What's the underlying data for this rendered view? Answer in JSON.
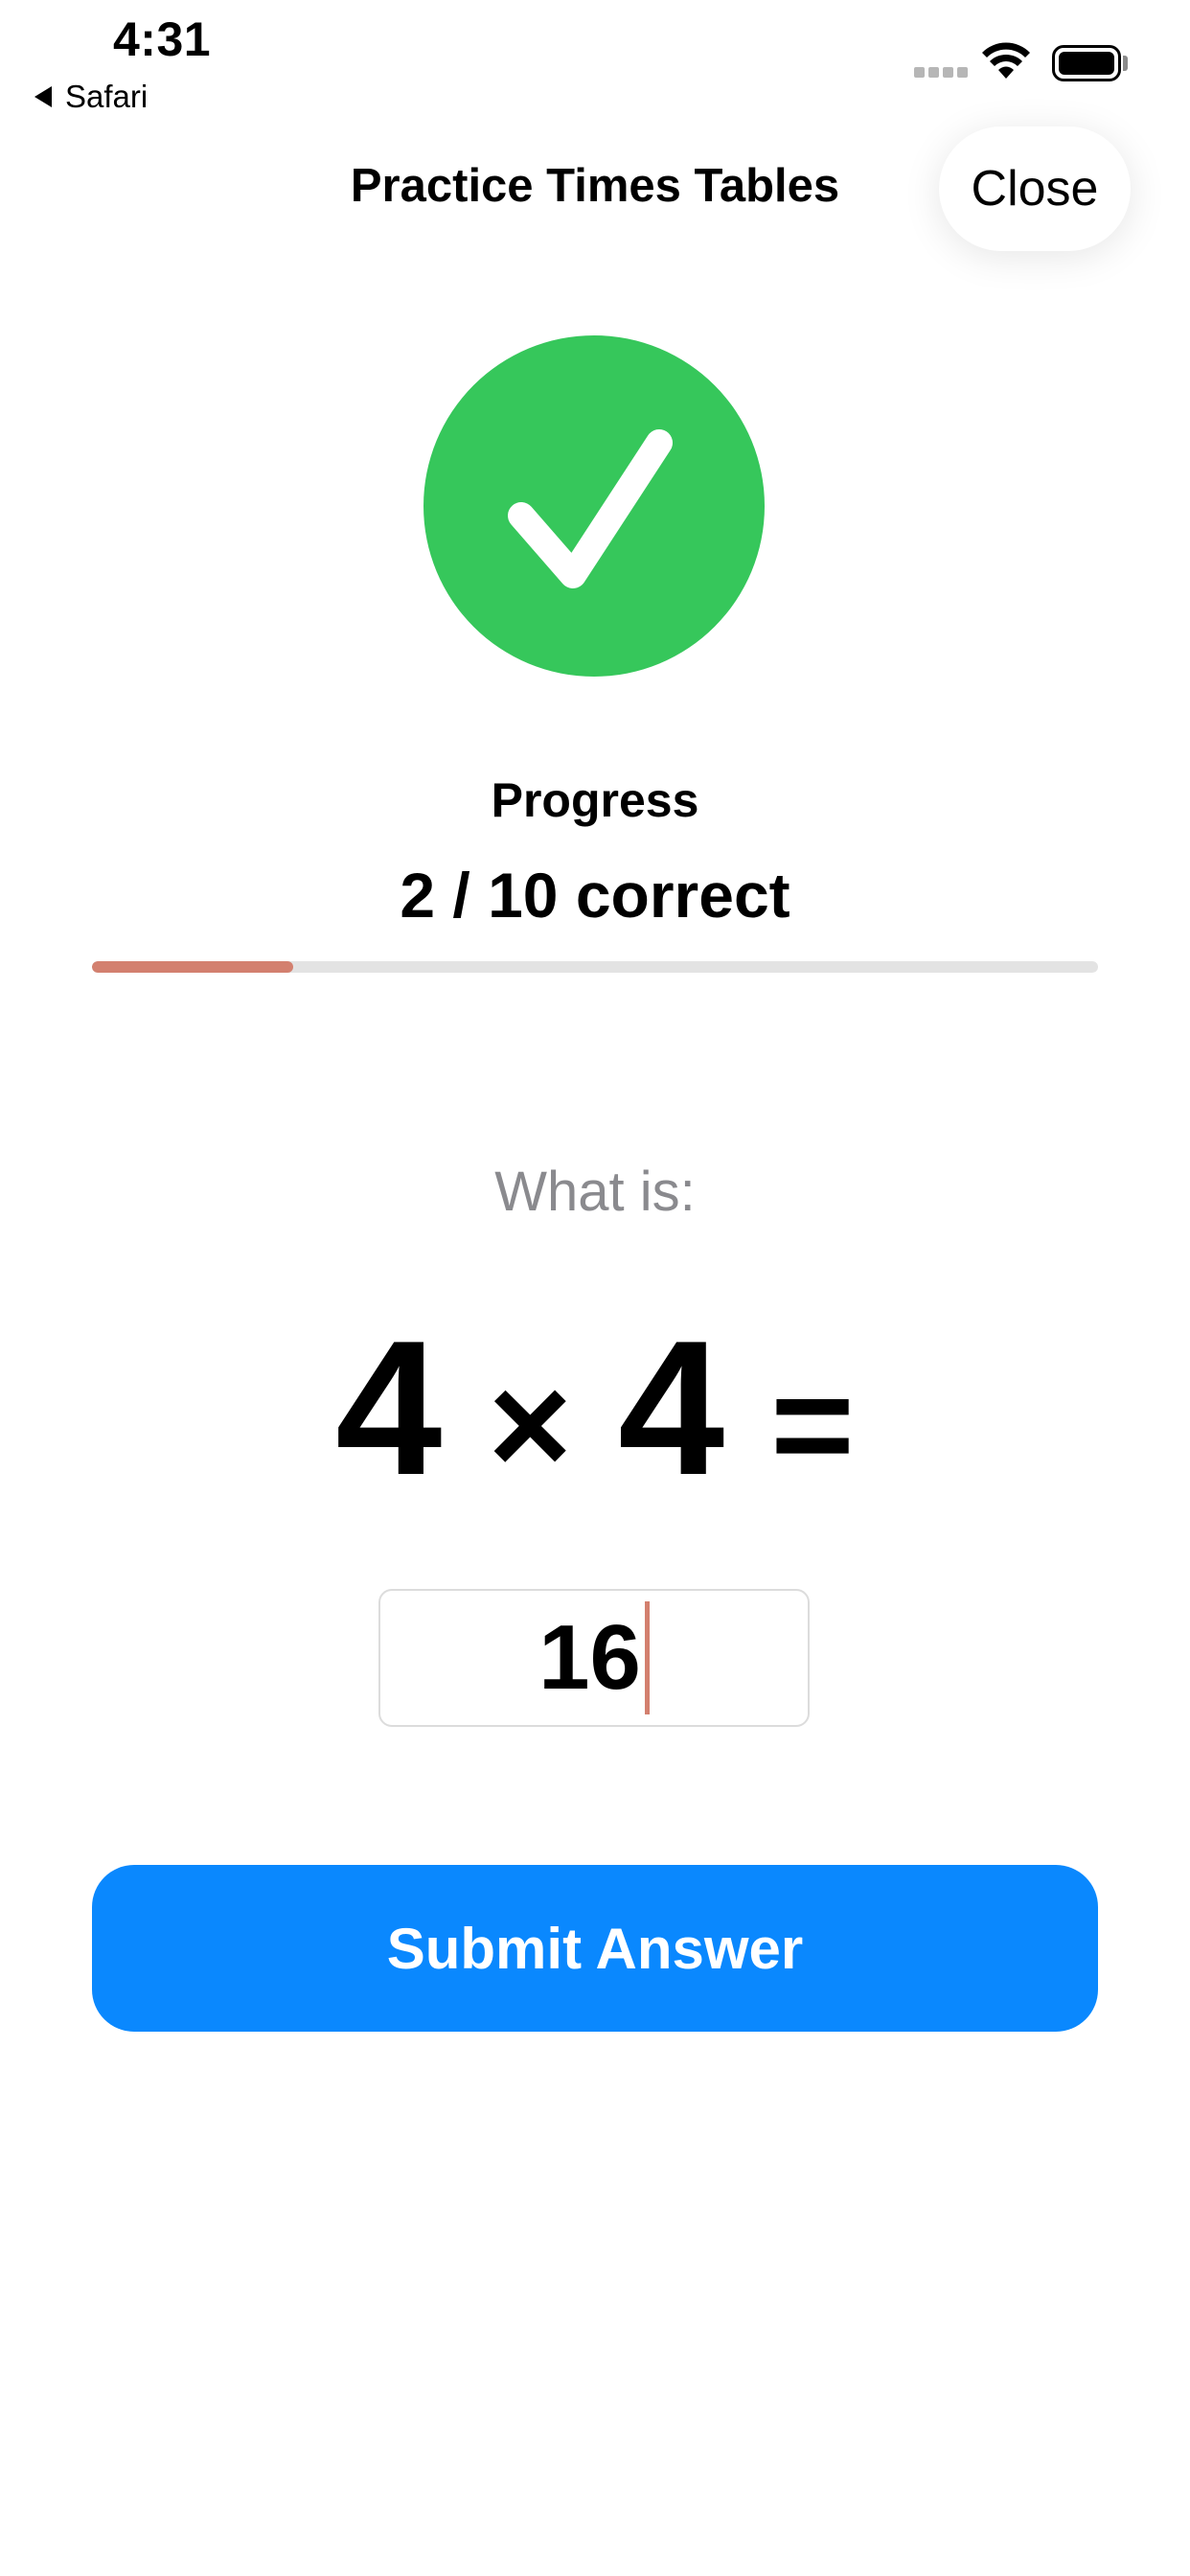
{
  "status_bar": {
    "time": "4:31",
    "back_app": "Safari",
    "icons": [
      "signal-dots-icon",
      "wifi-icon",
      "battery-icon"
    ]
  },
  "header": {
    "title": "Practice Times Tables",
    "close_label": "Close"
  },
  "feedback": {
    "icon": "checkmark-circle-icon",
    "color": "#36c75b"
  },
  "progress": {
    "label": "Progress",
    "count_text": "2 / 10 correct",
    "correct": 2,
    "total": 10,
    "fill_color": "#d3806f"
  },
  "question": {
    "prompt": "What is:",
    "left": "4",
    "operator": "×",
    "right": "4",
    "equals": "="
  },
  "answer": {
    "value": "16"
  },
  "submit": {
    "label": "Submit Answer",
    "color": "#0a88fe"
  }
}
